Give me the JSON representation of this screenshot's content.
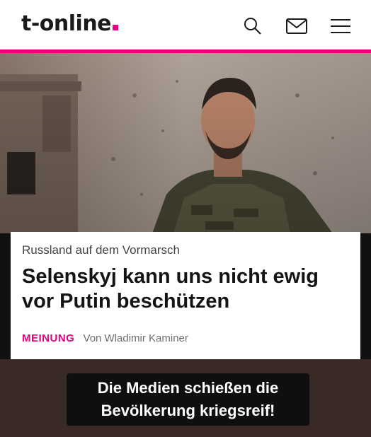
{
  "header": {
    "brand": "t-online",
    "brand_color": "#e6007e",
    "icons": [
      "search-icon",
      "mail-icon",
      "menu-icon"
    ]
  },
  "photo": {
    "description_icon": "hero-photo"
  },
  "article": {
    "kicker": "Russland auf dem Vormarsch",
    "headline": "Selenskyj kann uns nicht ewig vor Putin beschützen",
    "category": "MEINUNG",
    "author": "Von Wladimir Kaminer"
  },
  "caption": {
    "line1": "Die Medien schießen die",
    "line2": "Bevölkerung kriegsreif!"
  },
  "colors": {
    "accent": "#e6007e",
    "caption_bg": "#0f0f0f",
    "bottom_bg": "#3a2a25"
  }
}
